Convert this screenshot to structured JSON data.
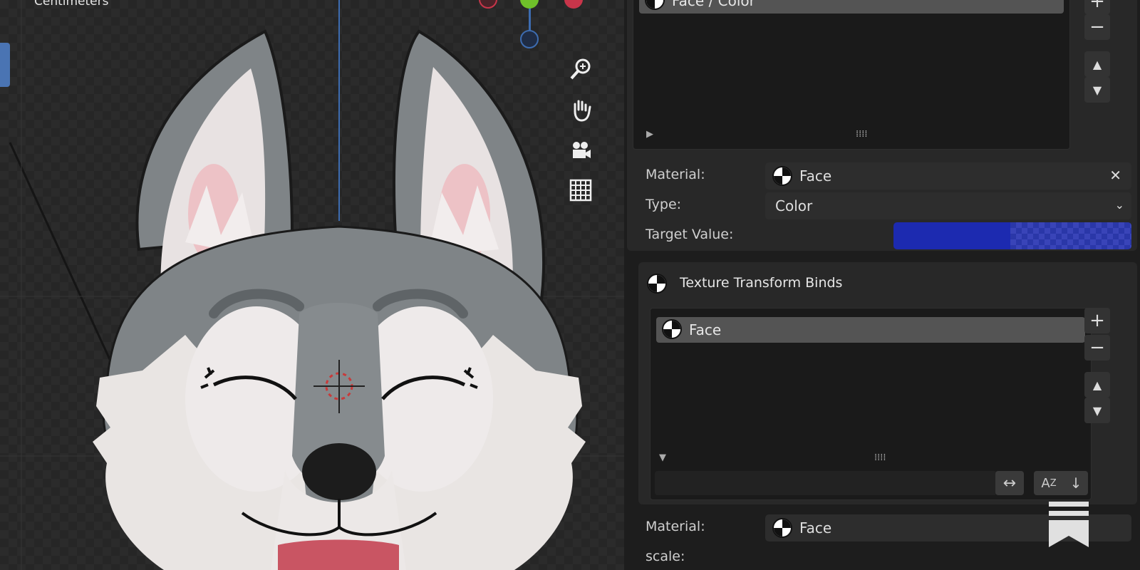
{
  "viewport": {
    "unit_label": "Centimeters"
  },
  "shape_key_list": {
    "item": "Face / Color"
  },
  "material_row_1": {
    "label": "Material:",
    "value": "Face",
    "clear_icon": "✕"
  },
  "type_row": {
    "label": "Type:",
    "value": "Color"
  },
  "target_row": {
    "label": "Target Value:",
    "color": "#1c2ab0"
  },
  "texture_binds": {
    "title": "Texture Transform Binds",
    "item": "Face"
  },
  "material_row_2": {
    "label": "Material:",
    "value": "Face"
  },
  "scale_row": {
    "label": "scale:"
  },
  "colors": {
    "accent": "#4a74b3",
    "target_blue": "#1c2ab0"
  }
}
